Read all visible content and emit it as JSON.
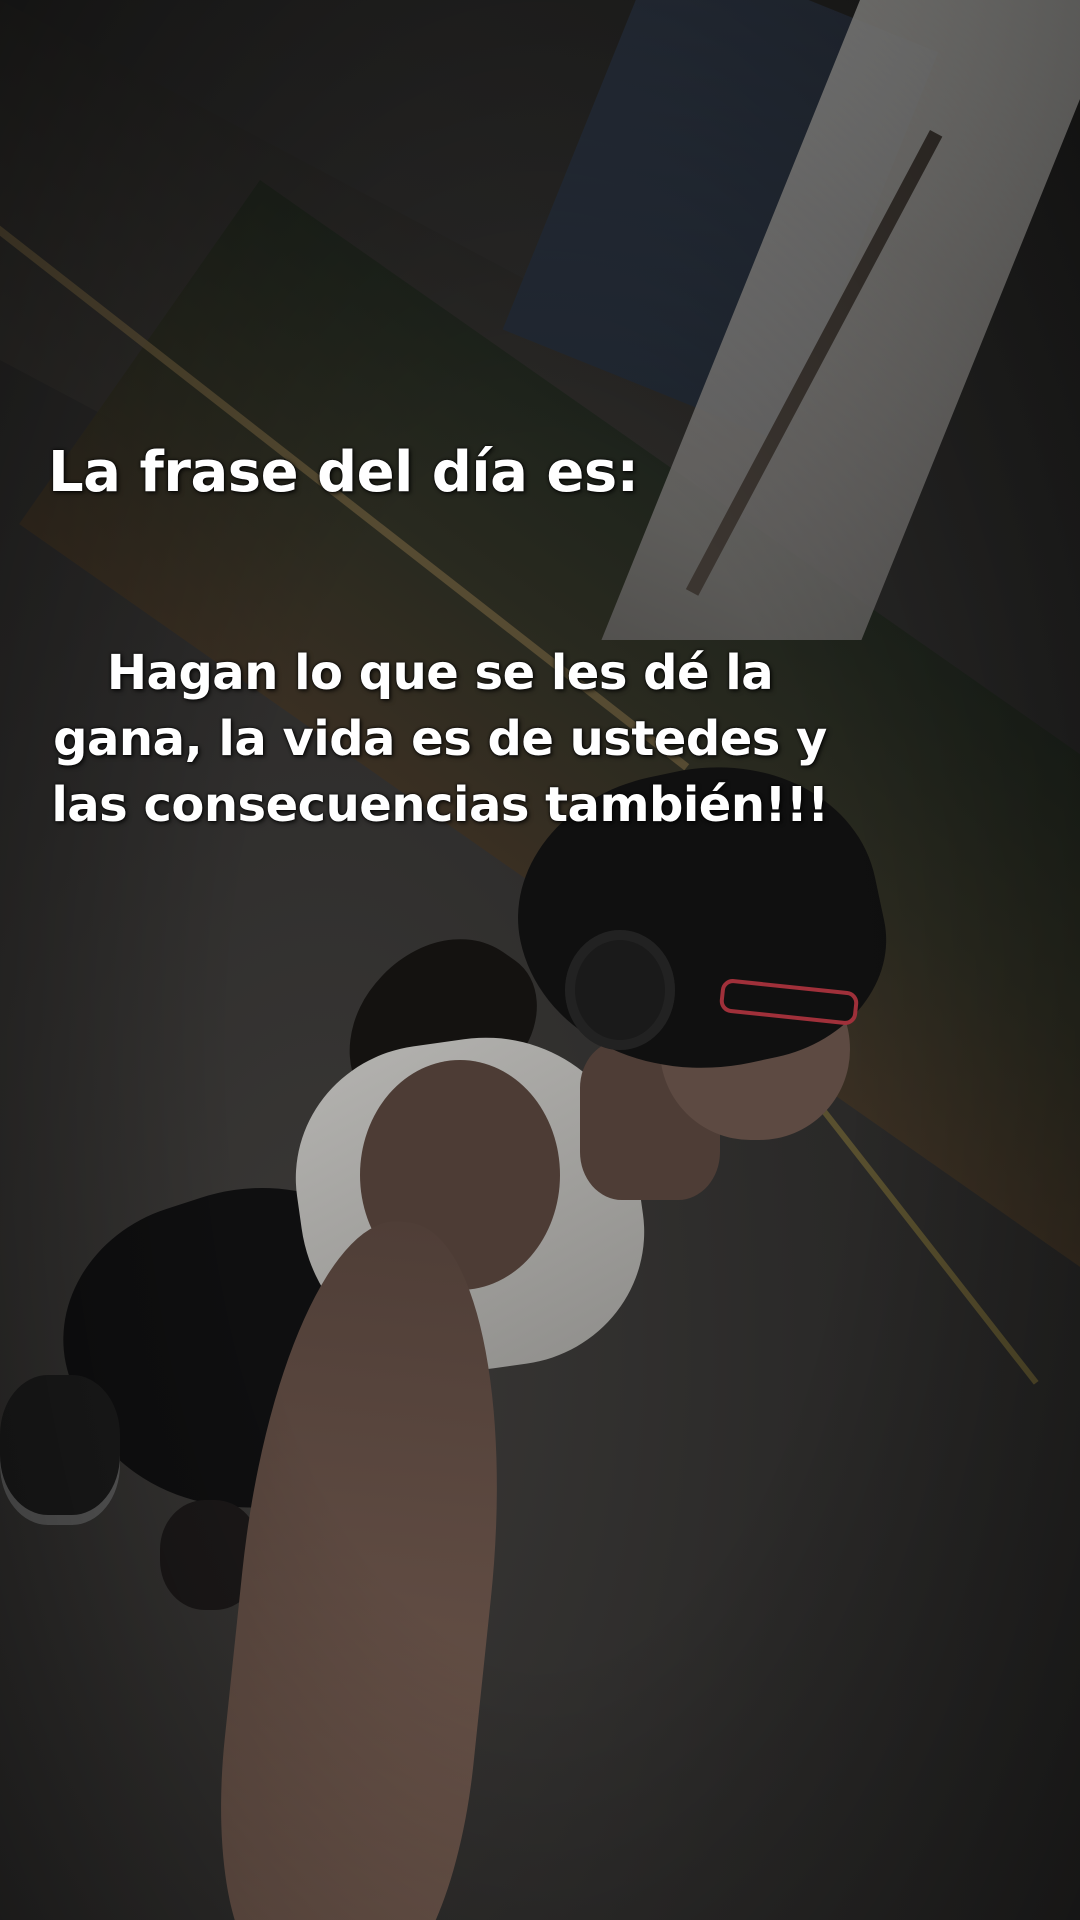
{
  "overlay": {
    "title": "La frase del día es:",
    "quote": "Hagan lo que se les dé la gana, la vida es de ustedes y las consecuencias también!!!"
  },
  "colors": {
    "caption_text": "#ffffff",
    "glasses_frame": "#a0303a"
  }
}
